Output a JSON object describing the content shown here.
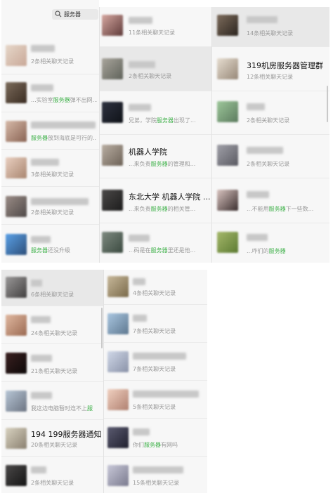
{
  "search": {
    "query": "服务器"
  },
  "colors": {
    "highlight": "#3fb14a",
    "subtext": "#9a9a9a"
  },
  "panelA": {
    "items": [
      {
        "sub": "2条相关聊天记录"
      },
      {
        "pre": "...实验室",
        "hl": "服务器",
        "post": "弹不出网..."
      },
      {
        "pre": "",
        "hl": "服务器",
        "post": "放到海底是可行的..."
      },
      {
        "sub": "3条相关聊天记录"
      },
      {
        "sub": "2条相关聊天记录"
      },
      {
        "pre": "",
        "hl": "服务器",
        "post": "还没升级"
      }
    ]
  },
  "panelB": {
    "items": [
      {
        "sub": "11条相关聊天记录"
      },
      {
        "sub": "2条相关聊天记录"
      },
      {
        "pre": "兄弟，学院",
        "hl": "服务器",
        "post": "出现了..."
      },
      {
        "title": "机器人学院",
        "pre": "...来负责",
        "hl": "服务器",
        "post": "的管理和..."
      },
      {
        "title": "东北大学 机器人学院 ...",
        "pre": "...来负责",
        "hl": "服务器",
        "post": "的相关管..."
      },
      {
        "pre": "...码是在",
        "hl": "服务器",
        "post": "里还是他..."
      }
    ]
  },
  "panelC": {
    "items": [
      {
        "sub": "14条相关聊天记录"
      },
      {
        "title": "319机房服务器管理群",
        "sub": "12条相关聊天记录"
      },
      {
        "sub": "2条相关聊天记录"
      },
      {
        "sub": "2条相关聊天记录"
      },
      {
        "pre": "...不能用",
        "hl": "服务器",
        "post": "下一些数..."
      },
      {
        "pre": "...咋们的",
        "hl": "服务器",
        "post": ""
      }
    ]
  },
  "panelD": {
    "items": [
      {
        "sub": "6条相关聊天记录"
      },
      {
        "sub": "24条相关聊天记录"
      },
      {
        "sub": "21条相关聊天记录"
      },
      {
        "pre": "我这边电脑暂时连不上",
        "hl": "服",
        "post": ""
      },
      {
        "title": "194 199服务器通知群",
        "sub": "20条相关聊天记录"
      },
      {
        "sub": "2条相关聊天记录"
      }
    ]
  },
  "panelE": {
    "items": [
      {
        "sub": "4条相关聊天记录"
      },
      {
        "sub": "7条相关聊天记录"
      },
      {
        "sub": "7条相关聊天记录"
      },
      {
        "sub": "5条相关聊天记录"
      },
      {
        "pre": "你们",
        "hl": "服务器",
        "post": "有网吗"
      },
      {
        "sub": "15条相关聊天记录"
      }
    ]
  }
}
